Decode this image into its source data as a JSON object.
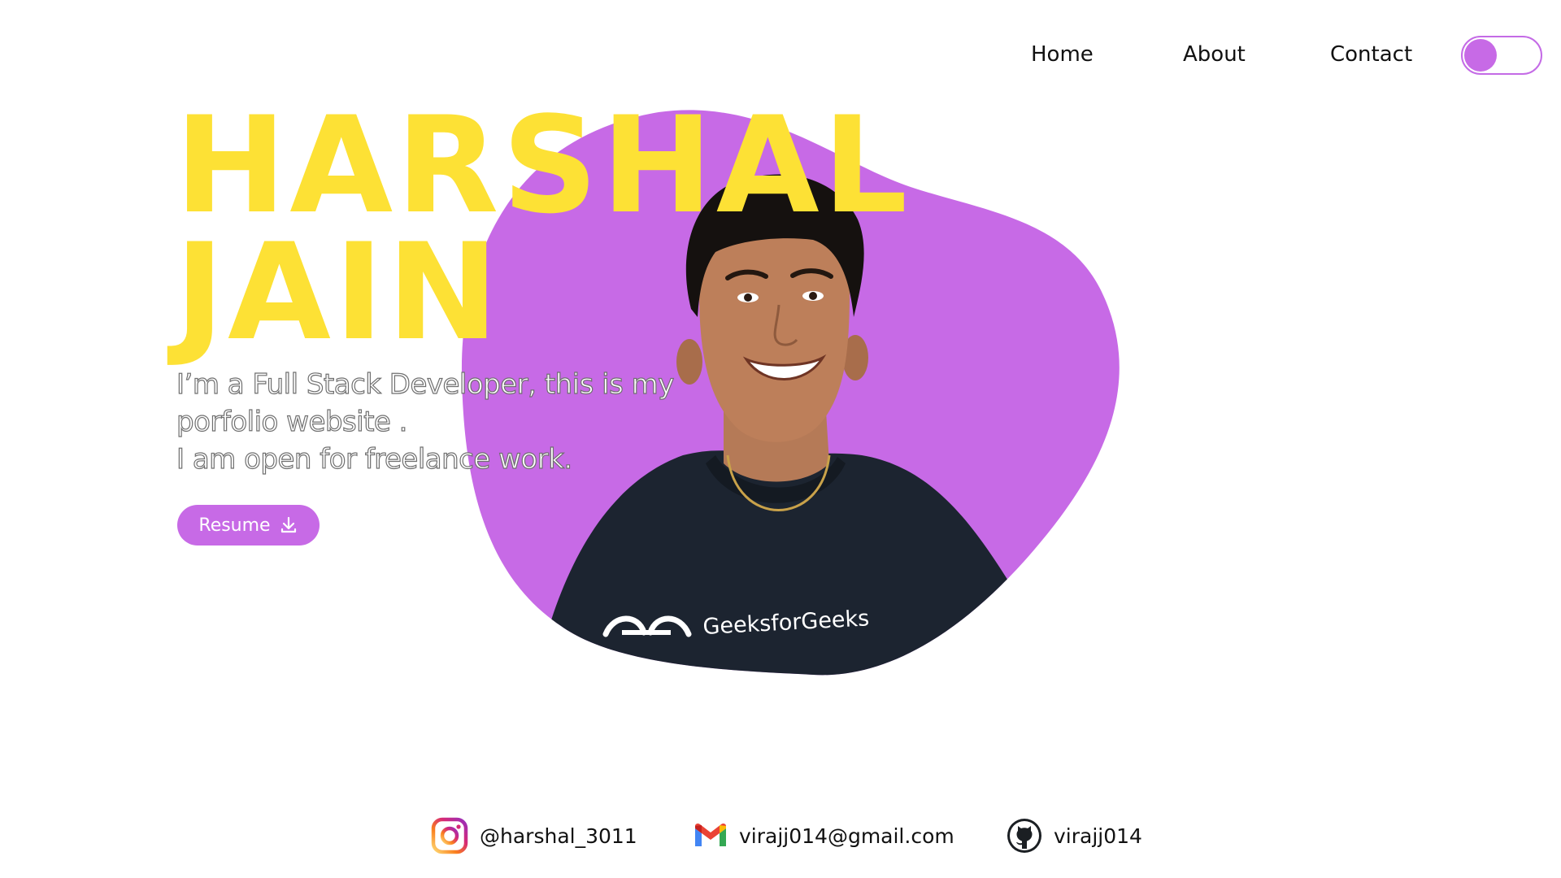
{
  "nav": {
    "links": [
      {
        "label": "Home"
      },
      {
        "label": "About"
      },
      {
        "label": "Contact"
      }
    ],
    "theme_toggle": {
      "state": "off"
    }
  },
  "hero": {
    "first_name": "HARSHAL",
    "last_name": "JAIN",
    "intro_lines": [
      "I’m a Full Stack Developer, this is my",
      "porfolio website .",
      "I am open for freelance work."
    ],
    "resume_label": "Resume",
    "photo": {
      "shirt_text": "GeeksforGeeks"
    }
  },
  "contacts": [
    {
      "icon": "instagram-icon",
      "label": "@harshal_3011"
    },
    {
      "icon": "gmail-icon",
      "label": "virajj014@gmail.com"
    },
    {
      "icon": "github-icon",
      "label": "virajj014"
    }
  ],
  "colors": {
    "accent_purple": "#c76ae6",
    "name_yellow": "#fde135",
    "text_dark": "#111111",
    "outline_gray": "#6f6f6f"
  }
}
